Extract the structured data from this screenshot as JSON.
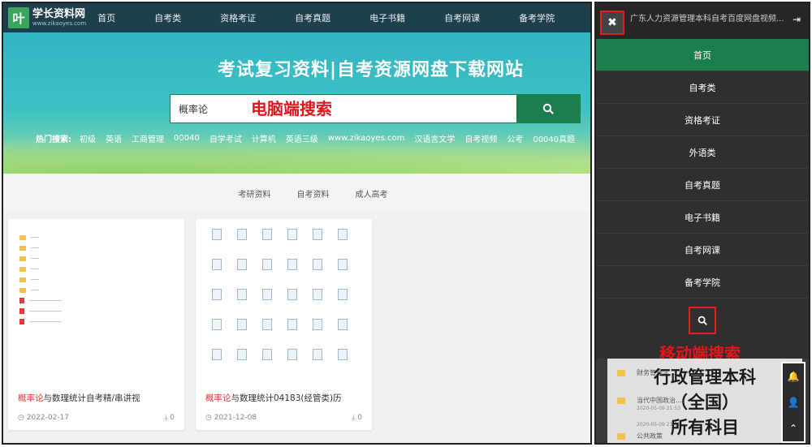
{
  "desktop": {
    "logo": {
      "name": "学长资料网",
      "url": "www.zikaoyes.com"
    },
    "nav": [
      "首页",
      "自考类",
      "资格考证",
      "自考真题",
      "电子书籍",
      "自考网课",
      "备考学院"
    ],
    "hero_title": "考试复习资料|自考资源网盘下载网站",
    "search": {
      "value": "概率论"
    },
    "annotation_pc": "电脑端搜索",
    "hot_label": "热门搜索:",
    "hot_items": [
      "初级",
      "英语",
      "工商管理",
      "00040",
      "自学考试",
      "计算机",
      "英语三级",
      "www.zikaoyes.com",
      "汉语言文学",
      "自考视频",
      "公考",
      "00040真题"
    ],
    "categories": [
      "考研资料",
      "自考资料",
      "成人高考"
    ],
    "cards": [
      {
        "title_hl": "概率论",
        "title_rest": "与数理统计自考精/串讲视",
        "date": "2022-02-17",
        "downloads": "0"
      },
      {
        "title_hl": "概率论",
        "title_rest": "与数理统计04183(经管类)历",
        "date": "2021-12-08",
        "downloads": "0"
      }
    ]
  },
  "mobile": {
    "top_title": "广东人力资源管理本科自考百度网盘视频...",
    "menu": [
      "首页",
      "自考类",
      "资格考证",
      "外语类",
      "自考真题",
      "电子书籍",
      "自考网课",
      "备考学院"
    ],
    "annotation_mobile": "移动端搜索",
    "overlay_lines": [
      "行政管理本科",
      "（全国）",
      "所有科目"
    ],
    "list_items": [
      "财务管理学...",
      "当代中国政治...",
      "公共政策"
    ],
    "list_dates": [
      "2020-05-09 21:53",
      "2020-05-09 21:53"
    ]
  },
  "colors": {
    "brand_green": "#1a7e4d",
    "header_dark": "#1e3f4c",
    "annotation_red": "#e8141b"
  }
}
